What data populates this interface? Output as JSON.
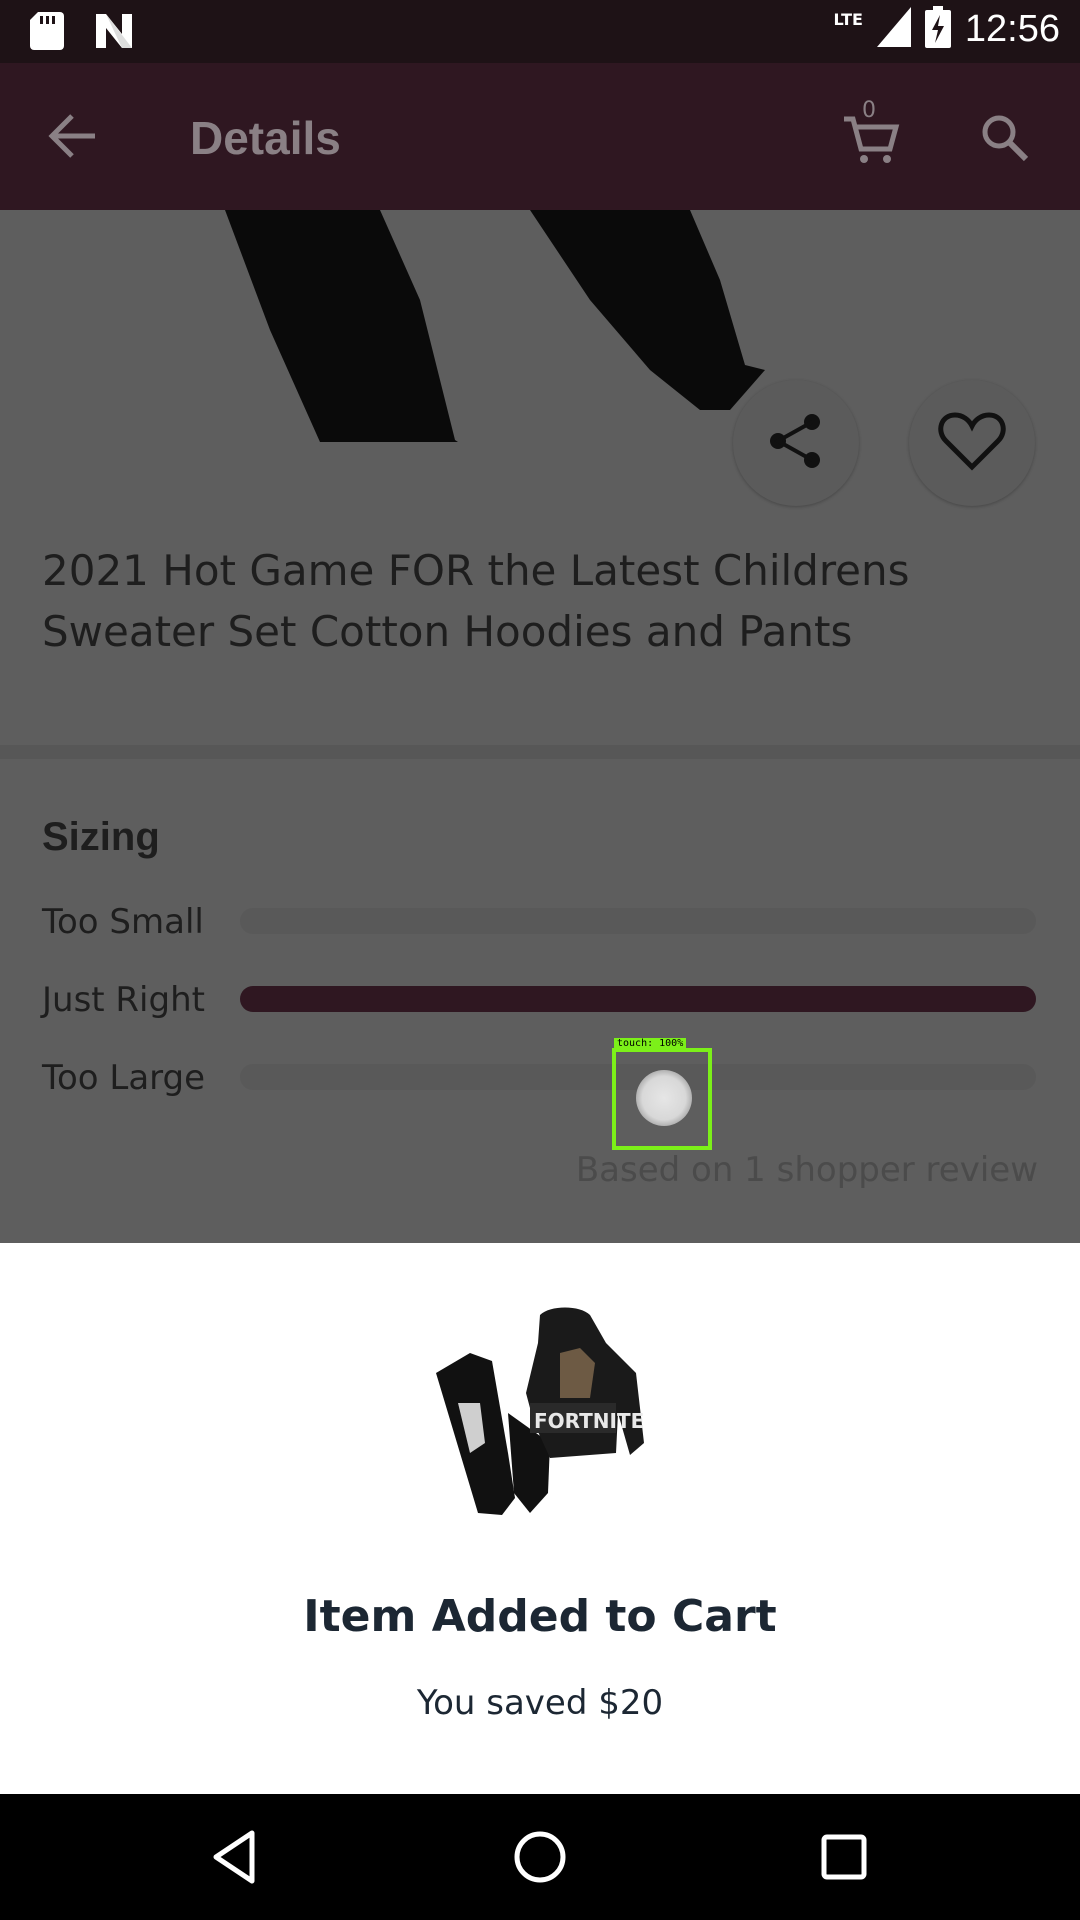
{
  "status_bar": {
    "time": "12:56",
    "network": "LTE",
    "icons": [
      "sd-card-icon",
      "n-logo-icon",
      "signal-icon",
      "battery-charging-icon"
    ]
  },
  "header": {
    "title": "Details",
    "cart_count": "0",
    "icons": [
      "back-arrow-icon",
      "cart-icon",
      "search-icon"
    ]
  },
  "product": {
    "title": "2021 Hot Game FOR the Latest Childrens Sweater Set Cotton Hoodies and Pants"
  },
  "sizing": {
    "title": "Sizing",
    "rows": [
      {
        "label": "Too Small",
        "fraction": 0
      },
      {
        "label": "Just Right",
        "fraction": 1
      },
      {
        "label": "Too Large",
        "fraction": 0
      }
    ],
    "note": "Based on 1 shopper review"
  },
  "touch_indicator": {
    "label": "touch: 100%"
  },
  "sheet": {
    "title": "Item Added to Cart",
    "subtitle": "You saved $20"
  },
  "nav": {
    "icons": [
      "back-triangle-icon",
      "home-circle-icon",
      "recents-square-icon"
    ]
  }
}
